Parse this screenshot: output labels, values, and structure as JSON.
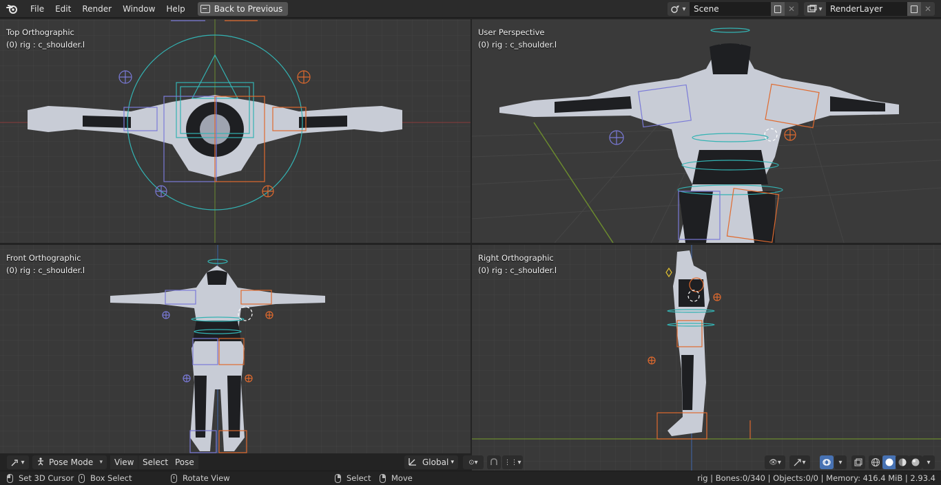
{
  "menubar": {
    "items": [
      "File",
      "Edit",
      "Render",
      "Window",
      "Help"
    ],
    "back_button": "Back to Previous"
  },
  "scene_selector": {
    "value": "Scene"
  },
  "layer_selector": {
    "value": "RenderLayer"
  },
  "viewports": {
    "top_left": {
      "view": "Top Orthographic",
      "object": "(0) rig : c_shoulder.l"
    },
    "top_right": {
      "view": "User Perspective",
      "object": "(0) rig : c_shoulder.l"
    },
    "bottom_left": {
      "view": "Front Orthographic",
      "object": "(0) rig : c_shoulder.l"
    },
    "bottom_right": {
      "view": "Right Orthographic",
      "object": "(0) rig : c_shoulder.l"
    }
  },
  "header": {
    "mode": "Pose Mode",
    "menus": [
      "View",
      "Select",
      "Pose"
    ],
    "orientation": "Global"
  },
  "statusbar": {
    "set_cursor": "Set 3D Cursor",
    "box_select": "Box Select",
    "rotate_view": "Rotate View",
    "select": "Select",
    "move": "Move",
    "info": "rig | Bones:0/340 | Objects:0/0 | Memory: 416.4 MiB | 2.93.4"
  },
  "colors": {
    "bone_left": "#7a7ad8",
    "bone_right": "#e06a2e",
    "bone_center": "#33b3b3",
    "armor_light": "#c8ccd6",
    "armor_dark": "#1e1f22"
  }
}
